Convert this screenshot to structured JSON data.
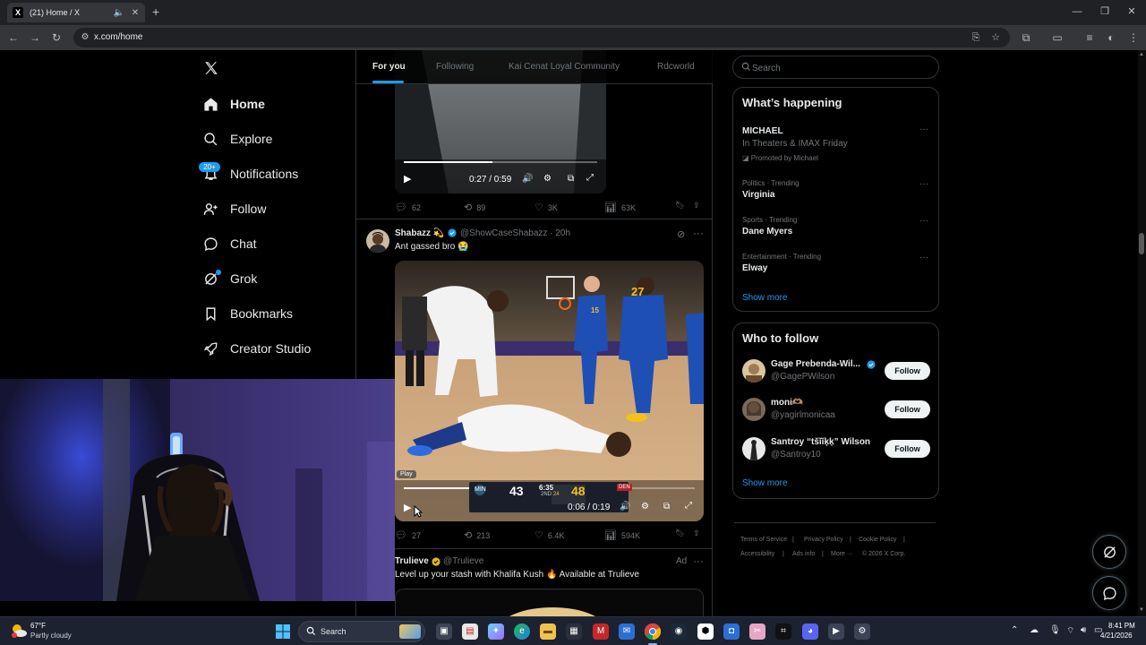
{
  "browser": {
    "tab_title": "(21) Home / X",
    "tab_favicon": "X",
    "url": "x.com/home"
  },
  "nav": {
    "items": [
      {
        "label": "Home",
        "icon": "home-icon"
      },
      {
        "label": "Explore",
        "icon": "search-icon"
      },
      {
        "label": "Notifications",
        "icon": "bell-icon"
      },
      {
        "label": "Follow",
        "icon": "person-plus-icon"
      },
      {
        "label": "Chat",
        "icon": "chat-icon"
      },
      {
        "label": "Grok",
        "icon": "grok-icon"
      },
      {
        "label": "Bookmarks",
        "icon": "bookmark-icon"
      },
      {
        "label": "Creator Studio",
        "icon": "rocket-icon"
      }
    ],
    "notifications_badge": "20+"
  },
  "feed": {
    "tabs": [
      "For you",
      "Following",
      "Kai Cenat Loyal Community",
      "Rdcworld"
    ],
    "post1": {
      "video_time": "0:27 / 0:59",
      "replies": "62",
      "reposts": "89",
      "likes": "3K",
      "views": "63K"
    },
    "post2": {
      "author": "Shabazz 💫",
      "handle": "@ShowCaseShabazz",
      "time": "· 20h",
      "text": "Ant gassed bro 😭",
      "play_tooltip": "Play",
      "video_time": "0:06 / 0:19",
      "replies": "27",
      "reposts": "213",
      "likes": "6.4K",
      "views": "594K",
      "scoreboard": {
        "min_score": "43",
        "clock": "6:35",
        "quarter": "2ND",
        "shot_clock": "24",
        "den_score": "48",
        "home": "DEN",
        "away": "MIN"
      },
      "jerseys": [
        "27",
        "15"
      ]
    },
    "post3": {
      "author": "Trulieve",
      "handle": "@Trulieve",
      "ad_label": "Ad",
      "text": "Level up your stash with Khalifa Kush 🔥 Available at Trulieve"
    }
  },
  "sidebar": {
    "search_placeholder": "Search",
    "whats_happening": {
      "title": "What’s happening",
      "trends": [
        {
          "meta": "",
          "name": "MICHAEL",
          "sub": "In Theaters & IMAX Friday",
          "promo": "Promoted by Michael"
        },
        {
          "meta": "Politics · Trending",
          "name": "Virginia"
        },
        {
          "meta": "Sports · Trending",
          "name": "Dane Myers"
        },
        {
          "meta": "Entertainment · Trending",
          "name": "Elway"
        }
      ],
      "show_more": "Show more"
    },
    "who_to_follow": {
      "title": "Who to follow",
      "users": [
        {
          "name": "Gage Prebenda-Wil...",
          "handle": "@GagePWilson",
          "button": "Follow"
        },
        {
          "name": "moni🫶🏽",
          "handle": "@yagirlmonicaa",
          "button": "Follow"
        },
        {
          "name": "Santroy “tšĩǐķķ” Wilson",
          "handle": "@Santroy10",
          "button": "Follow"
        }
      ],
      "show_more": "Show more"
    },
    "footer": [
      "Terms of Service",
      "Privacy Policy",
      "Cookie Policy",
      "Accessibility",
      "Ads info",
      "More ···",
      "© 2026 X Corp."
    ]
  },
  "taskbar": {
    "weather_temp": "67°F",
    "weather_desc": "Partly cloudy",
    "search_label": "Search",
    "time": "8:41 PM",
    "date": "4/21/2026"
  },
  "colors": {
    "accent": "#1d9bf0",
    "verified": "#1d9bf0",
    "border": "#2f3336",
    "muted": "#71767b"
  }
}
